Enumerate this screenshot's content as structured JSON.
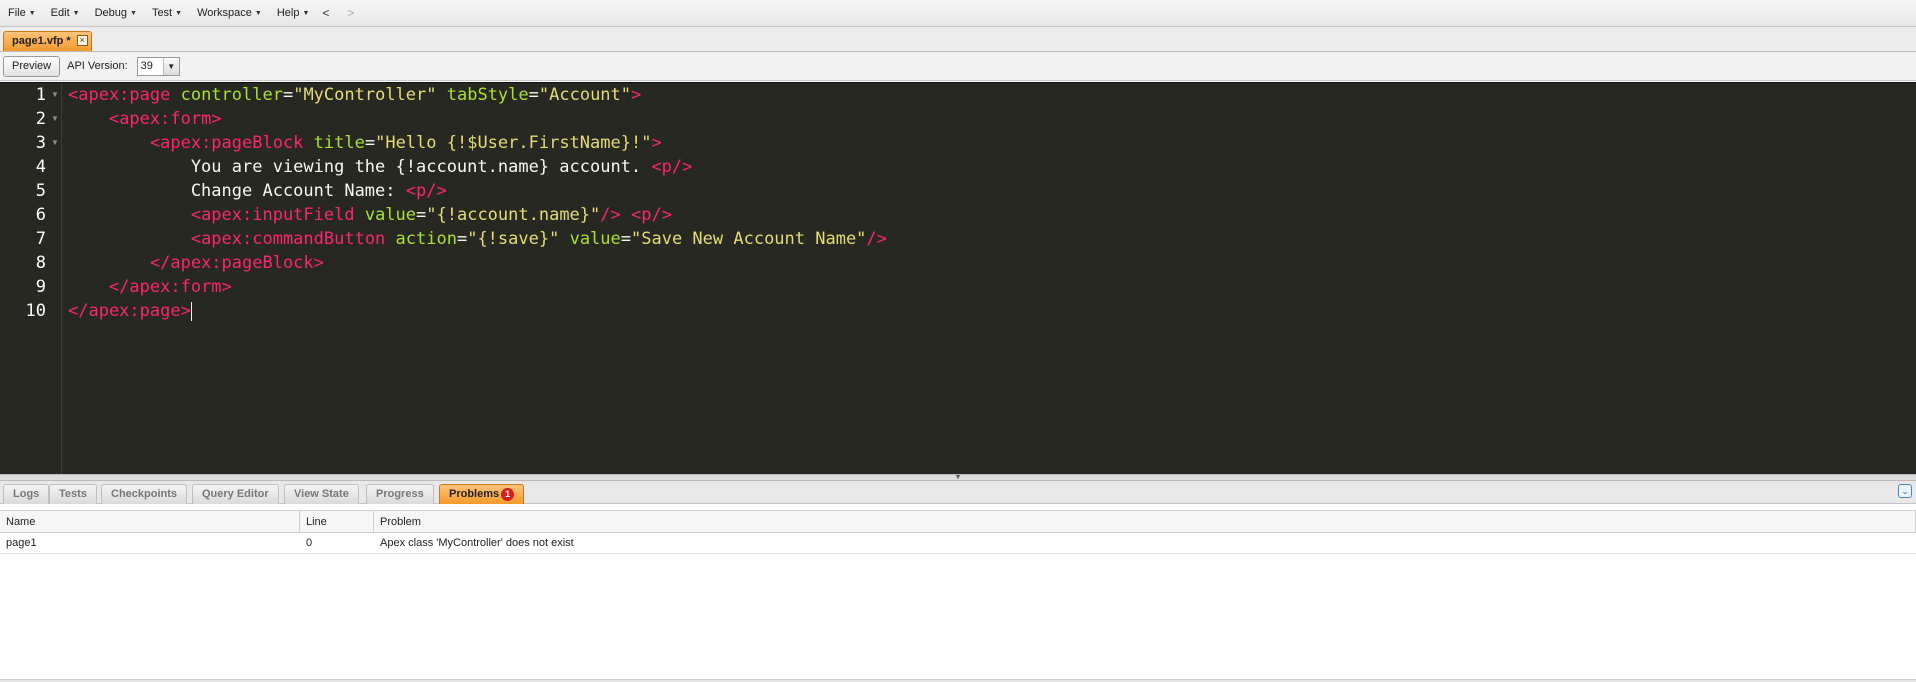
{
  "menu": {
    "items": [
      {
        "label": "File"
      },
      {
        "label": "Edit"
      },
      {
        "label": "Debug"
      },
      {
        "label": "Test"
      },
      {
        "label": "Workspace"
      },
      {
        "label": "Help"
      }
    ],
    "back": "<",
    "forward": ">"
  },
  "file_tab": {
    "label": "page1.vfp *",
    "close": "×"
  },
  "toolbar": {
    "preview_label": "Preview",
    "api_label": "API Version:",
    "api_value": "39"
  },
  "editor": {
    "line_numbers": [
      "1",
      "2",
      "3",
      "4",
      "5",
      "6",
      "7",
      "8",
      "9",
      "10"
    ],
    "lines": [
      [
        [
          "t",
          "<apex:page "
        ],
        [
          "a",
          "controller"
        ],
        [
          "p",
          "="
        ],
        [
          "s",
          "\"MyController\""
        ],
        [
          "p",
          " "
        ],
        [
          "a",
          "tabStyle"
        ],
        [
          "p",
          "="
        ],
        [
          "s",
          "\"Account\""
        ],
        [
          "t",
          ">"
        ]
      ],
      [
        [
          "p",
          "    "
        ],
        [
          "t",
          "<apex:form>"
        ]
      ],
      [
        [
          "p",
          "        "
        ],
        [
          "t",
          "<apex:pageBlock "
        ],
        [
          "a",
          "title"
        ],
        [
          "p",
          "="
        ],
        [
          "s",
          "\"Hello {!$User.FirstName}!\""
        ],
        [
          "t",
          ">"
        ]
      ],
      [
        [
          "p",
          "            You are viewing the {!account.name} account. "
        ],
        [
          "t",
          "<p/>"
        ]
      ],
      [
        [
          "p",
          "            Change Account Name: "
        ],
        [
          "t",
          "<p/>"
        ]
      ],
      [
        [
          "p",
          "            "
        ],
        [
          "t",
          "<apex:inputField "
        ],
        [
          "a",
          "value"
        ],
        [
          "p",
          "="
        ],
        [
          "s",
          "\"{!account.name}\""
        ],
        [
          "t",
          "/>"
        ],
        [
          "p",
          " "
        ],
        [
          "t",
          "<p/>"
        ]
      ],
      [
        [
          "p",
          "            "
        ],
        [
          "t",
          "<apex:commandButton "
        ],
        [
          "a",
          "action"
        ],
        [
          "p",
          "="
        ],
        [
          "s",
          "\"{!save}\""
        ],
        [
          "p",
          " "
        ],
        [
          "a",
          "value"
        ],
        [
          "p",
          "="
        ],
        [
          "s",
          "\"Save New Account Name\""
        ],
        [
          "t",
          "/>"
        ]
      ],
      [
        [
          "p",
          "        "
        ],
        [
          "t",
          "</apex:pageBlock>"
        ]
      ],
      [
        [
          "p",
          "    "
        ],
        [
          "t",
          "</apex:form>"
        ]
      ],
      [
        [
          "t",
          "</apex:page>"
        ]
      ]
    ],
    "folded_lines": [
      1,
      2,
      3
    ],
    "colors": {
      "background": "#272822",
      "tag": "#f92672",
      "attribute": "#a6e22e",
      "string": "#e6db74",
      "text": "#f8f8f2"
    }
  },
  "bottom_tabs": [
    {
      "label": "Logs",
      "active": false
    },
    {
      "label": "Tests",
      "active": false
    },
    {
      "label": "Checkpoints",
      "active": false
    },
    {
      "label": "Query Editor",
      "active": false
    },
    {
      "label": "View State",
      "active": false
    },
    {
      "label": "Progress",
      "active": false
    },
    {
      "label": "Problems",
      "active": true,
      "badge": "1"
    }
  ],
  "problems": {
    "columns": [
      "Name",
      "Line",
      "Problem"
    ],
    "rows": [
      {
        "name": "page1",
        "line": "0",
        "problem": "Apex class 'MyController' does not exist"
      }
    ]
  },
  "colors": {
    "accent_tab": "#f39a2c",
    "badge": "#d3201a"
  }
}
